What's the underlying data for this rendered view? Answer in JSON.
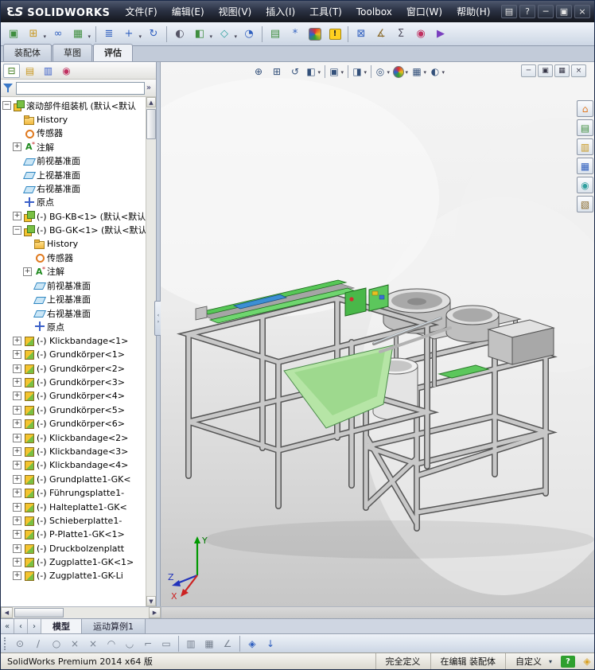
{
  "titlebar": {
    "logo": {
      "n3": "3",
      "s": "S",
      "brand": "SOLIDWORKS"
    },
    "menus": [
      {
        "label": "文件(F)"
      },
      {
        "label": "编辑(E)"
      },
      {
        "label": "视图(V)"
      },
      {
        "label": "插入(I)"
      },
      {
        "label": "工具(T)"
      },
      {
        "label": "Toolbox"
      },
      {
        "label": "窗口(W)"
      },
      {
        "label": "帮助(H)"
      }
    ],
    "controls": [
      {
        "name": "new-document-button",
        "glyph": "▤"
      },
      {
        "name": "help-button",
        "glyph": "?"
      },
      {
        "name": "minimize-button",
        "glyph": "─"
      },
      {
        "name": "restore-button",
        "glyph": "▣"
      },
      {
        "name": "close-button",
        "glyph": "×"
      }
    ]
  },
  "main_toolbar": {
    "items": [
      {
        "name": "edit-component-button",
        "glyph": "▣",
        "color": "#3f8e3f"
      },
      {
        "name": "insert-components-button",
        "glyph": "⊞",
        "color": "#c8971f",
        "dd": true
      },
      {
        "name": "mate-button",
        "glyph": "∞",
        "color": "#2f5fbf"
      },
      {
        "name": "linear-component-pattern-button",
        "glyph": "▦",
        "color": "#3f8e3f",
        "dd": true
      },
      {
        "sep": true
      },
      {
        "name": "smart-fasteners-button",
        "glyph": "≣",
        "color": "#2f5fbf"
      },
      {
        "name": "move-component-button",
        "glyph": "+",
        "color": "#2f5fbf",
        "dd": true
      },
      {
        "name": "rotate-component-button",
        "glyph": "↻",
        "color": "#2f5fbf"
      },
      {
        "sep": true
      },
      {
        "name": "show-hidden-components-button",
        "glyph": "◐",
        "color": "#556"
      },
      {
        "name": "assembly-features-button",
        "glyph": "◧",
        "color": "#3f8e3f",
        "dd": true
      },
      {
        "name": "reference-geometry-button",
        "glyph": "◇",
        "color": "#2f9f9f",
        "dd": true
      },
      {
        "name": "new-motion-study-button",
        "glyph": "◔",
        "color": "#2f5fbf"
      },
      {
        "sep": true
      },
      {
        "name": "bill-of-materials-button",
        "glyph": "▤",
        "color": "#3f8e3f"
      },
      {
        "name": "exploded-view-button",
        "glyph": "*",
        "color": "#2f5fbf"
      },
      {
        "name": "edit-appearance-button",
        "cls": "rainbow",
        "glyph": ""
      },
      {
        "name": "warning-indicator",
        "cls": "warn",
        "glyph": "!"
      },
      {
        "sep": true
      },
      {
        "name": "interference-detection-button",
        "glyph": "⊠",
        "color": "#2f5fbf"
      },
      {
        "name": "measure-button",
        "glyph": "∡",
        "color": "#8a6a2a"
      },
      {
        "name": "mass-properties-button",
        "glyph": "Σ",
        "color": "#556"
      },
      {
        "name": "appearance-sphere-button",
        "glyph": "◉",
        "color": "#c03060"
      },
      {
        "name": "simulation-advisor-button",
        "glyph": "▶",
        "color": "#7a3fbf"
      }
    ]
  },
  "command_tabs": {
    "items": [
      {
        "label": "装配体"
      },
      {
        "label": "草图"
      },
      {
        "label": "评估",
        "active": true
      }
    ]
  },
  "headsup_toolbar": {
    "items": [
      {
        "name": "zoom-fit-button",
        "glyph": "⊕"
      },
      {
        "name": "zoom-area-button",
        "glyph": "⊞"
      },
      {
        "name": "previous-view-button",
        "glyph": "↺"
      },
      {
        "name": "section-view-button",
        "glyph": "◧",
        "dd": true
      },
      {
        "sep": true
      },
      {
        "name": "view-orientation-button",
        "glyph": "▣",
        "dd": true
      },
      {
        "sep": true
      },
      {
        "name": "display-style-button",
        "glyph": "◨",
        "dd": true
      },
      {
        "sep": true
      },
      {
        "name": "hide-show-items-button",
        "glyph": "◎",
        "dd": true
      },
      {
        "name": "edit-appearance-button",
        "cls": "rainbow2",
        "glyph": "",
        "dd": true
      },
      {
        "name": "apply-scene-button",
        "glyph": "▦",
        "dd": true
      },
      {
        "name": "view-settings-button",
        "glyph": "◐",
        "dd": true
      }
    ]
  },
  "doc_window_controls": {
    "items": [
      {
        "name": "doc-minimize-button",
        "glyph": "─"
      },
      {
        "name": "doc-restore-button",
        "glyph": "▣"
      },
      {
        "name": "doc-new-window-button",
        "glyph": "▦"
      },
      {
        "name": "doc-close-button",
        "glyph": "×"
      }
    ]
  },
  "feature_panel": {
    "tabs": [
      {
        "name": "featuremanager-tree-tab",
        "glyph": "⊟",
        "color": "#3f7a1f",
        "active": true
      },
      {
        "name": "propertymanager-tab",
        "glyph": "▤",
        "color": "#c8971f"
      },
      {
        "name": "configurationmanager-tab",
        "glyph": "▥",
        "color": "#3a5fc8"
      },
      {
        "name": "displaymanager-tab",
        "glyph": "◉",
        "color": "#c03060"
      }
    ],
    "overflow_chevron": "»",
    "filter": {
      "placeholder": ""
    },
    "splitter": {
      "left": "‹",
      "right": "›"
    },
    "expand_glyphs": {
      "plus": "+",
      "minus": "−"
    },
    "tree_items": [
      {
        "icon": "asm",
        "label": "滚动部件组装机 (默认<默认",
        "expand": "minus",
        "indent": 0
      },
      {
        "icon": "hist",
        "label": "History",
        "expand": "none",
        "indent": 1
      },
      {
        "icon": "sensor",
        "label": "传感器",
        "expand": "none",
        "indent": 1
      },
      {
        "icon": "ann",
        "label": "注解",
        "expand": "plus",
        "indent": 1
      },
      {
        "icon": "plane",
        "label": "前视基准面",
        "expand": "none",
        "indent": 1
      },
      {
        "icon": "plane",
        "label": "上视基准面",
        "expand": "none",
        "indent": 1
      },
      {
        "icon": "plane",
        "label": "右视基准面",
        "expand": "none",
        "indent": 1
      },
      {
        "icon": "origin",
        "label": "原点",
        "expand": "none",
        "indent": 1
      },
      {
        "icon": "asm",
        "label": "(-) BG-KB<1> (默认<默认",
        "expand": "plus",
        "indent": 1
      },
      {
        "icon": "asm",
        "label": "(-) BG-GK<1> (默认<默认",
        "expand": "minus",
        "indent": 1
      },
      {
        "icon": "hist",
        "label": "History",
        "expand": "none",
        "indent": 2
      },
      {
        "icon": "sensor",
        "label": "传感器",
        "expand": "none",
        "indent": 2
      },
      {
        "icon": "ann",
        "label": "注解",
        "expand": "plus",
        "indent": 2
      },
      {
        "icon": "plane",
        "label": "前视基准面",
        "expand": "none",
        "indent": 2
      },
      {
        "icon": "plane",
        "label": "上视基准面",
        "expand": "none",
        "indent": 2
      },
      {
        "icon": "plane",
        "label": "右视基准面",
        "expand": "none",
        "indent": 2
      },
      {
        "icon": "origin",
        "label": "原点",
        "expand": "none",
        "indent": 2
      },
      {
        "icon": "part",
        "label": "(-) Klickbandage<1>",
        "expand": "plus",
        "indent": 1
      },
      {
        "icon": "part",
        "label": "(-) Grundkörper<1>",
        "expand": "plus",
        "indent": 1
      },
      {
        "icon": "part",
        "label": "(-) Grundkörper<2>",
        "expand": "plus",
        "indent": 1
      },
      {
        "icon": "part",
        "label": "(-) Grundkörper<3>",
        "expand": "plus",
        "indent": 1
      },
      {
        "icon": "part",
        "label": "(-) Grundkörper<4>",
        "expand": "plus",
        "indent": 1
      },
      {
        "icon": "part",
        "label": "(-) Grundkörper<5>",
        "expand": "plus",
        "indent": 1
      },
      {
        "icon": "part",
        "label": "(-) Grundkörper<6>",
        "expand": "plus",
        "indent": 1
      },
      {
        "icon": "part",
        "label": "(-) Klickbandage<2>",
        "expand": "plus",
        "indent": 1
      },
      {
        "icon": "part",
        "label": "(-) Klickbandage<3>",
        "expand": "plus",
        "indent": 1
      },
      {
        "icon": "part",
        "label": "(-) Klickbandage<4>",
        "expand": "plus",
        "indent": 1
      },
      {
        "icon": "part",
        "label": "(-) Grundplatte1-GK<",
        "expand": "plus",
        "indent": 1
      },
      {
        "icon": "part",
        "label": "(-) Führungsplatte1-",
        "expand": "plus",
        "indent": 1
      },
      {
        "icon": "part",
        "label": "(-) Halteplatte1-GK<",
        "expand": "plus",
        "indent": 1
      },
      {
        "icon": "part",
        "label": "(-) Schieberplatte1-",
        "expand": "plus",
        "indent": 1
      },
      {
        "icon": "part",
        "label": "(-) P-Platte1-GK<1>",
        "expand": "plus",
        "indent": 1
      },
      {
        "icon": "part",
        "label": "(-) Druckbolzenplatt",
        "expand": "plus",
        "indent": 1
      },
      {
        "icon": "part",
        "label": "(-) Zugplatte1-GK<1>",
        "expand": "plus",
        "indent": 1
      },
      {
        "icon": "part",
        "label": "(-) Zugplatte1-GK-Li",
        "expand": "plus",
        "indent": 1
      }
    ]
  },
  "viewport": {
    "triad": {
      "x": "X",
      "y": "Y",
      "z": "Z"
    }
  },
  "task_pane": {
    "items": [
      {
        "name": "solidworks-resources-tab",
        "glyph": "⌂",
        "color": "#e07820"
      },
      {
        "name": "design-library-tab",
        "glyph": "▤",
        "color": "#3f8e3f"
      },
      {
        "name": "file-explorer-tab",
        "glyph": "▥",
        "color": "#c8971f"
      },
      {
        "name": "view-palette-tab",
        "glyph": "▦",
        "color": "#2f5fbf"
      },
      {
        "name": "appearances-scenes-tab",
        "glyph": "◉",
        "color": "#2f9f9f"
      },
      {
        "name": "custom-properties-tab",
        "glyph": "▧",
        "color": "#8a6a2a"
      }
    ]
  },
  "model_tabs": {
    "nav": [
      {
        "name": "tab-scroll-first-button",
        "glyph": "«"
      },
      {
        "name": "tab-scroll-prev-button",
        "glyph": "‹"
      },
      {
        "name": "tab-scroll-next-button",
        "glyph": "›"
      }
    ],
    "tabs": [
      {
        "label": "模型",
        "active": true
      },
      {
        "label": "运动算例1"
      }
    ]
  },
  "sketch_toolbar": {
    "items": [
      {
        "name": "point-button",
        "glyph": "⊙"
      },
      {
        "name": "line-button",
        "glyph": "∕"
      },
      {
        "name": "circle-button",
        "glyph": "○"
      },
      {
        "name": "trim-entities-button",
        "glyph": "×"
      },
      {
        "name": "convert-entities-button",
        "glyph": "×"
      },
      {
        "name": "arc-button",
        "glyph": "◠"
      },
      {
        "name": "tangent-arc-button",
        "glyph": "◡"
      },
      {
        "name": "corner-button",
        "glyph": "⌐"
      },
      {
        "name": "rectangle-button",
        "glyph": "▭"
      },
      {
        "sep": true
      },
      {
        "name": "mirror-entities-button",
        "glyph": "▥"
      },
      {
        "name": "linear-sketch-pattern-button",
        "glyph": "▦"
      },
      {
        "name": "smart-dimension-button",
        "glyph": "∠"
      },
      {
        "sep": true
      },
      {
        "name": "isometric-view-button",
        "glyph": "◈",
        "color": "#2f5fbf"
      },
      {
        "name": "exit-sketch-button",
        "glyph": "↓",
        "color": "#2f5fbf"
      }
    ]
  },
  "statusbar": {
    "left": "SolidWorks Premium 2014 x64 版",
    "cells": [
      {
        "label": "完全定义"
      },
      {
        "label": "在编辑 装配体"
      },
      {
        "label": "自定义",
        "dd": true,
        "interactable": "true"
      }
    ],
    "help_glyph": "?",
    "grip_glyph": "◈"
  }
}
